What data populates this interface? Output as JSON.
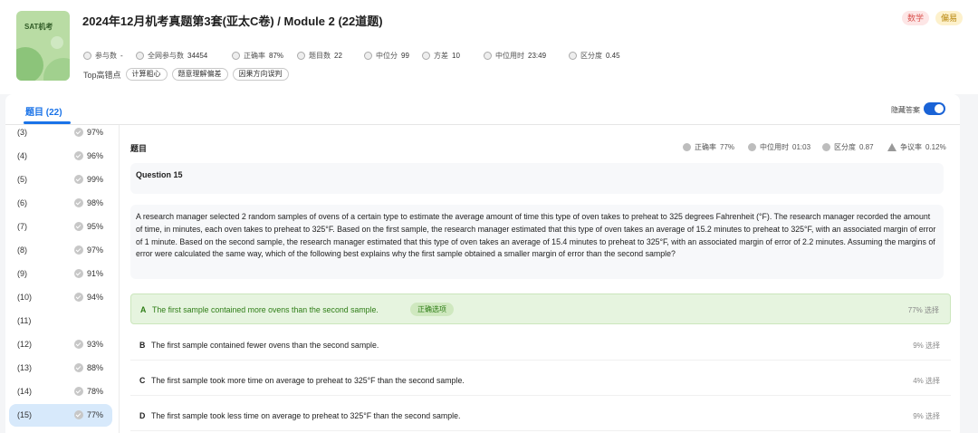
{
  "header": {
    "thumb_text": "SAT机考",
    "title": "2024年12月机考真题第3套(亚太C卷) / Module 2 (22道题)",
    "tags": [
      "数学",
      "偏易"
    ],
    "stats": [
      {
        "label": "参与数",
        "value": "-"
      },
      {
        "label": "全网参与数",
        "value": "34454"
      },
      {
        "label": "正确率",
        "value": "87%"
      },
      {
        "label": "题目数",
        "value": "22"
      },
      {
        "label": "中位分",
        "value": "99"
      },
      {
        "label": "方差",
        "value": "10"
      },
      {
        "label": "中位用时",
        "value": "23:49"
      },
      {
        "label": "区分度",
        "value": "0.45"
      }
    ],
    "top_label": "Top高错点",
    "top_chips": [
      "计算粗心",
      "题意理解偏差",
      "因果方向误判"
    ]
  },
  "tabs": {
    "active_label": "题目 (22)",
    "hide_answer_label": "隐藏答案",
    "hide_answer_on": true
  },
  "question_list": [
    {
      "num": "(3)",
      "pct": "97%"
    },
    {
      "num": "(4)",
      "pct": "96%"
    },
    {
      "num": "(5)",
      "pct": "99%"
    },
    {
      "num": "(6)",
      "pct": "98%"
    },
    {
      "num": "(7)",
      "pct": "95%"
    },
    {
      "num": "(8)",
      "pct": "97%"
    },
    {
      "num": "(9)",
      "pct": "91%"
    },
    {
      "num": "(10)",
      "pct": "94%"
    },
    {
      "num": "(11)",
      "pct": ""
    },
    {
      "num": "(12)",
      "pct": "93%"
    },
    {
      "num": "(13)",
      "pct": "88%"
    },
    {
      "num": "(14)",
      "pct": "78%"
    },
    {
      "num": "(15)",
      "pct": "77%",
      "active": true
    }
  ],
  "question": {
    "section_label": "题目",
    "metrics": [
      {
        "label": "正确率",
        "value": "77%"
      },
      {
        "label": "中位用时",
        "value": "01:03"
      },
      {
        "label": "区分度",
        "value": "0.87"
      },
      {
        "label": "争议率",
        "value": "0.12%"
      }
    ],
    "heading": "Question 15",
    "body": "A research manager selected 2 random samples of ovens of a certain type to estimate the average amount of time this type of oven takes to preheat to 325 degrees Fahrenheit (°F). The research manager recorded the amount of time, in minutes, each oven takes to preheat to 325°F. Based on the first sample, the research manager estimated that this type of oven takes an average of 15.2 minutes to preheat to 325°F, with an associated margin of error of 1 minute. Based on the second sample, the research manager estimated that this type of oven takes an average of 15.4 minutes to preheat to 325°F, with an associated margin of error of 2.2 minutes. Assuming the margins of error were calculated the same way, which of the following best explains why the first sample obtained a smaller margin of error than the second sample?",
    "correct_badge": "正确选项",
    "options": [
      {
        "letter": "A",
        "text": "The first sample contained more ovens than the second sample.",
        "pick": "77% 选择",
        "correct": true
      },
      {
        "letter": "B",
        "text": "The first sample contained fewer ovens than the second sample.",
        "pick": "9% 选择"
      },
      {
        "letter": "C",
        "text": "The first sample took more time on average to preheat to 325°F than the second sample.",
        "pick": "4% 选择"
      },
      {
        "letter": "D",
        "text": "The first sample took less time on average to preheat to 325°F than the second sample.",
        "pick": "9% 选择"
      }
    ]
  }
}
